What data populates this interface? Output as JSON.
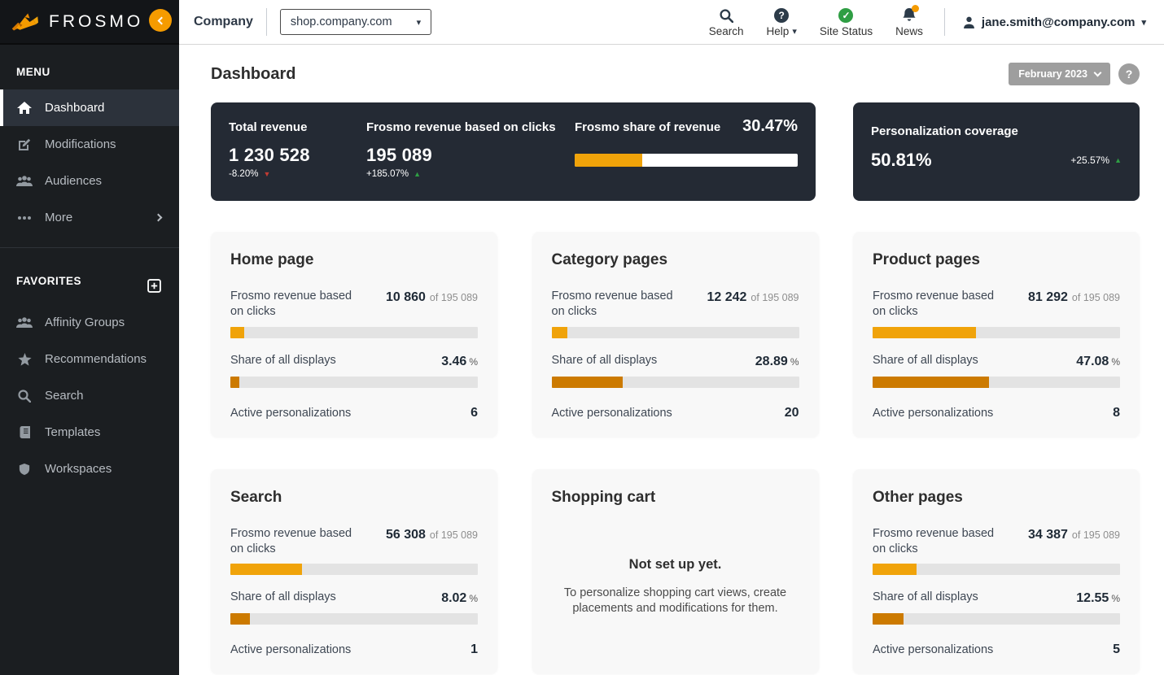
{
  "brand": {
    "logo_text": "FROSMO"
  },
  "sidebar": {
    "menu_label": "MENU",
    "menu_items": [
      {
        "label": "Dashboard",
        "icon": "home-icon",
        "active": true
      },
      {
        "label": "Modifications",
        "icon": "edit-icon",
        "active": false
      },
      {
        "label": "Audiences",
        "icon": "users-icon",
        "active": false
      },
      {
        "label": "More",
        "icon": "ellipsis-icon",
        "active": false,
        "has_submenu": true
      }
    ],
    "favorites_label": "FAVORITES",
    "favorites_add_icon": "plus-square-icon",
    "favorites_items": [
      {
        "label": "Affinity Groups",
        "icon": "users-icon"
      },
      {
        "label": "Recommendations",
        "icon": "star-icon"
      },
      {
        "label": "Search",
        "icon": "search-icon"
      },
      {
        "label": "Templates",
        "icon": "book-icon"
      },
      {
        "label": "Workspaces",
        "icon": "shield-icon"
      }
    ]
  },
  "topbar": {
    "company_label": "Company",
    "site_selector": {
      "value": "shop.company.com"
    },
    "nav_items": [
      {
        "label": "Search",
        "icon": "search-icon"
      },
      {
        "label": "Help",
        "icon": "help-circle-icon",
        "has_dropdown": true
      },
      {
        "label": "Site Status",
        "icon": "check-circle-icon"
      },
      {
        "label": "News",
        "icon": "bell-icon",
        "has_badge": true
      }
    ],
    "user": {
      "email": "jane.smith@company.com",
      "icon": "person-icon"
    }
  },
  "page": {
    "title": "Dashboard",
    "period_selector": "February 2023",
    "help_button": "?"
  },
  "kpi": {
    "total_revenue": {
      "label": "Total revenue",
      "value": "1 230 528",
      "delta": "-8.20%",
      "trend": "down"
    },
    "frosmo_revenue": {
      "label": "Frosmo revenue based on clicks",
      "value": "195 089",
      "delta": "+185.07%",
      "trend": "up"
    },
    "share_of_revenue": {
      "label": "Frosmo share of revenue",
      "value": "30.47%",
      "percent": 30.47
    },
    "personalization_coverage": {
      "label": "Personalization coverage",
      "value": "50.81%",
      "delta": "+25.57%",
      "trend": "up"
    }
  },
  "card_labels": {
    "revenue": "Frosmo revenue based on clicks",
    "of": "of",
    "share": "Share of all displays",
    "percent_unit": "%",
    "active": "Active personalizations"
  },
  "cards": [
    {
      "title": "Home page",
      "revenue_value": "10 860",
      "revenue_total": "195 089",
      "revenue_pct": 5.6,
      "share_value": "3.46",
      "share_pct": 3.46,
      "active_count": "6"
    },
    {
      "title": "Category pages",
      "revenue_value": "12 242",
      "revenue_total": "195 089",
      "revenue_pct": 6.3,
      "share_value": "28.89",
      "share_pct": 28.89,
      "active_count": "20"
    },
    {
      "title": "Product pages",
      "revenue_value": "81 292",
      "revenue_total": "195 089",
      "revenue_pct": 41.7,
      "share_value": "47.08",
      "share_pct": 47.08,
      "active_count": "8"
    },
    {
      "title": "Search",
      "revenue_value": "56 308",
      "revenue_total": "195 089",
      "revenue_pct": 28.9,
      "share_value": "8.02",
      "share_pct": 8.02,
      "active_count": "1"
    },
    {
      "title": "Shopping cart",
      "empty": true,
      "empty_title": "Not set up yet.",
      "empty_message": "To personalize shopping cart views, create placements and modifications for them."
    },
    {
      "title": "Other pages",
      "revenue_value": "34 387",
      "revenue_total": "195 089",
      "revenue_pct": 17.6,
      "share_value": "12.55",
      "share_pct": 12.55,
      "active_count": "5"
    }
  ],
  "colors": {
    "brand_orange": "#f59b00",
    "bar_amber": "#f0a30a",
    "bar_dark_orange": "#cc7a00",
    "dark_card_bg": "#242a34",
    "positive_green": "#2f9e44",
    "negative_red": "#c23b33"
  }
}
